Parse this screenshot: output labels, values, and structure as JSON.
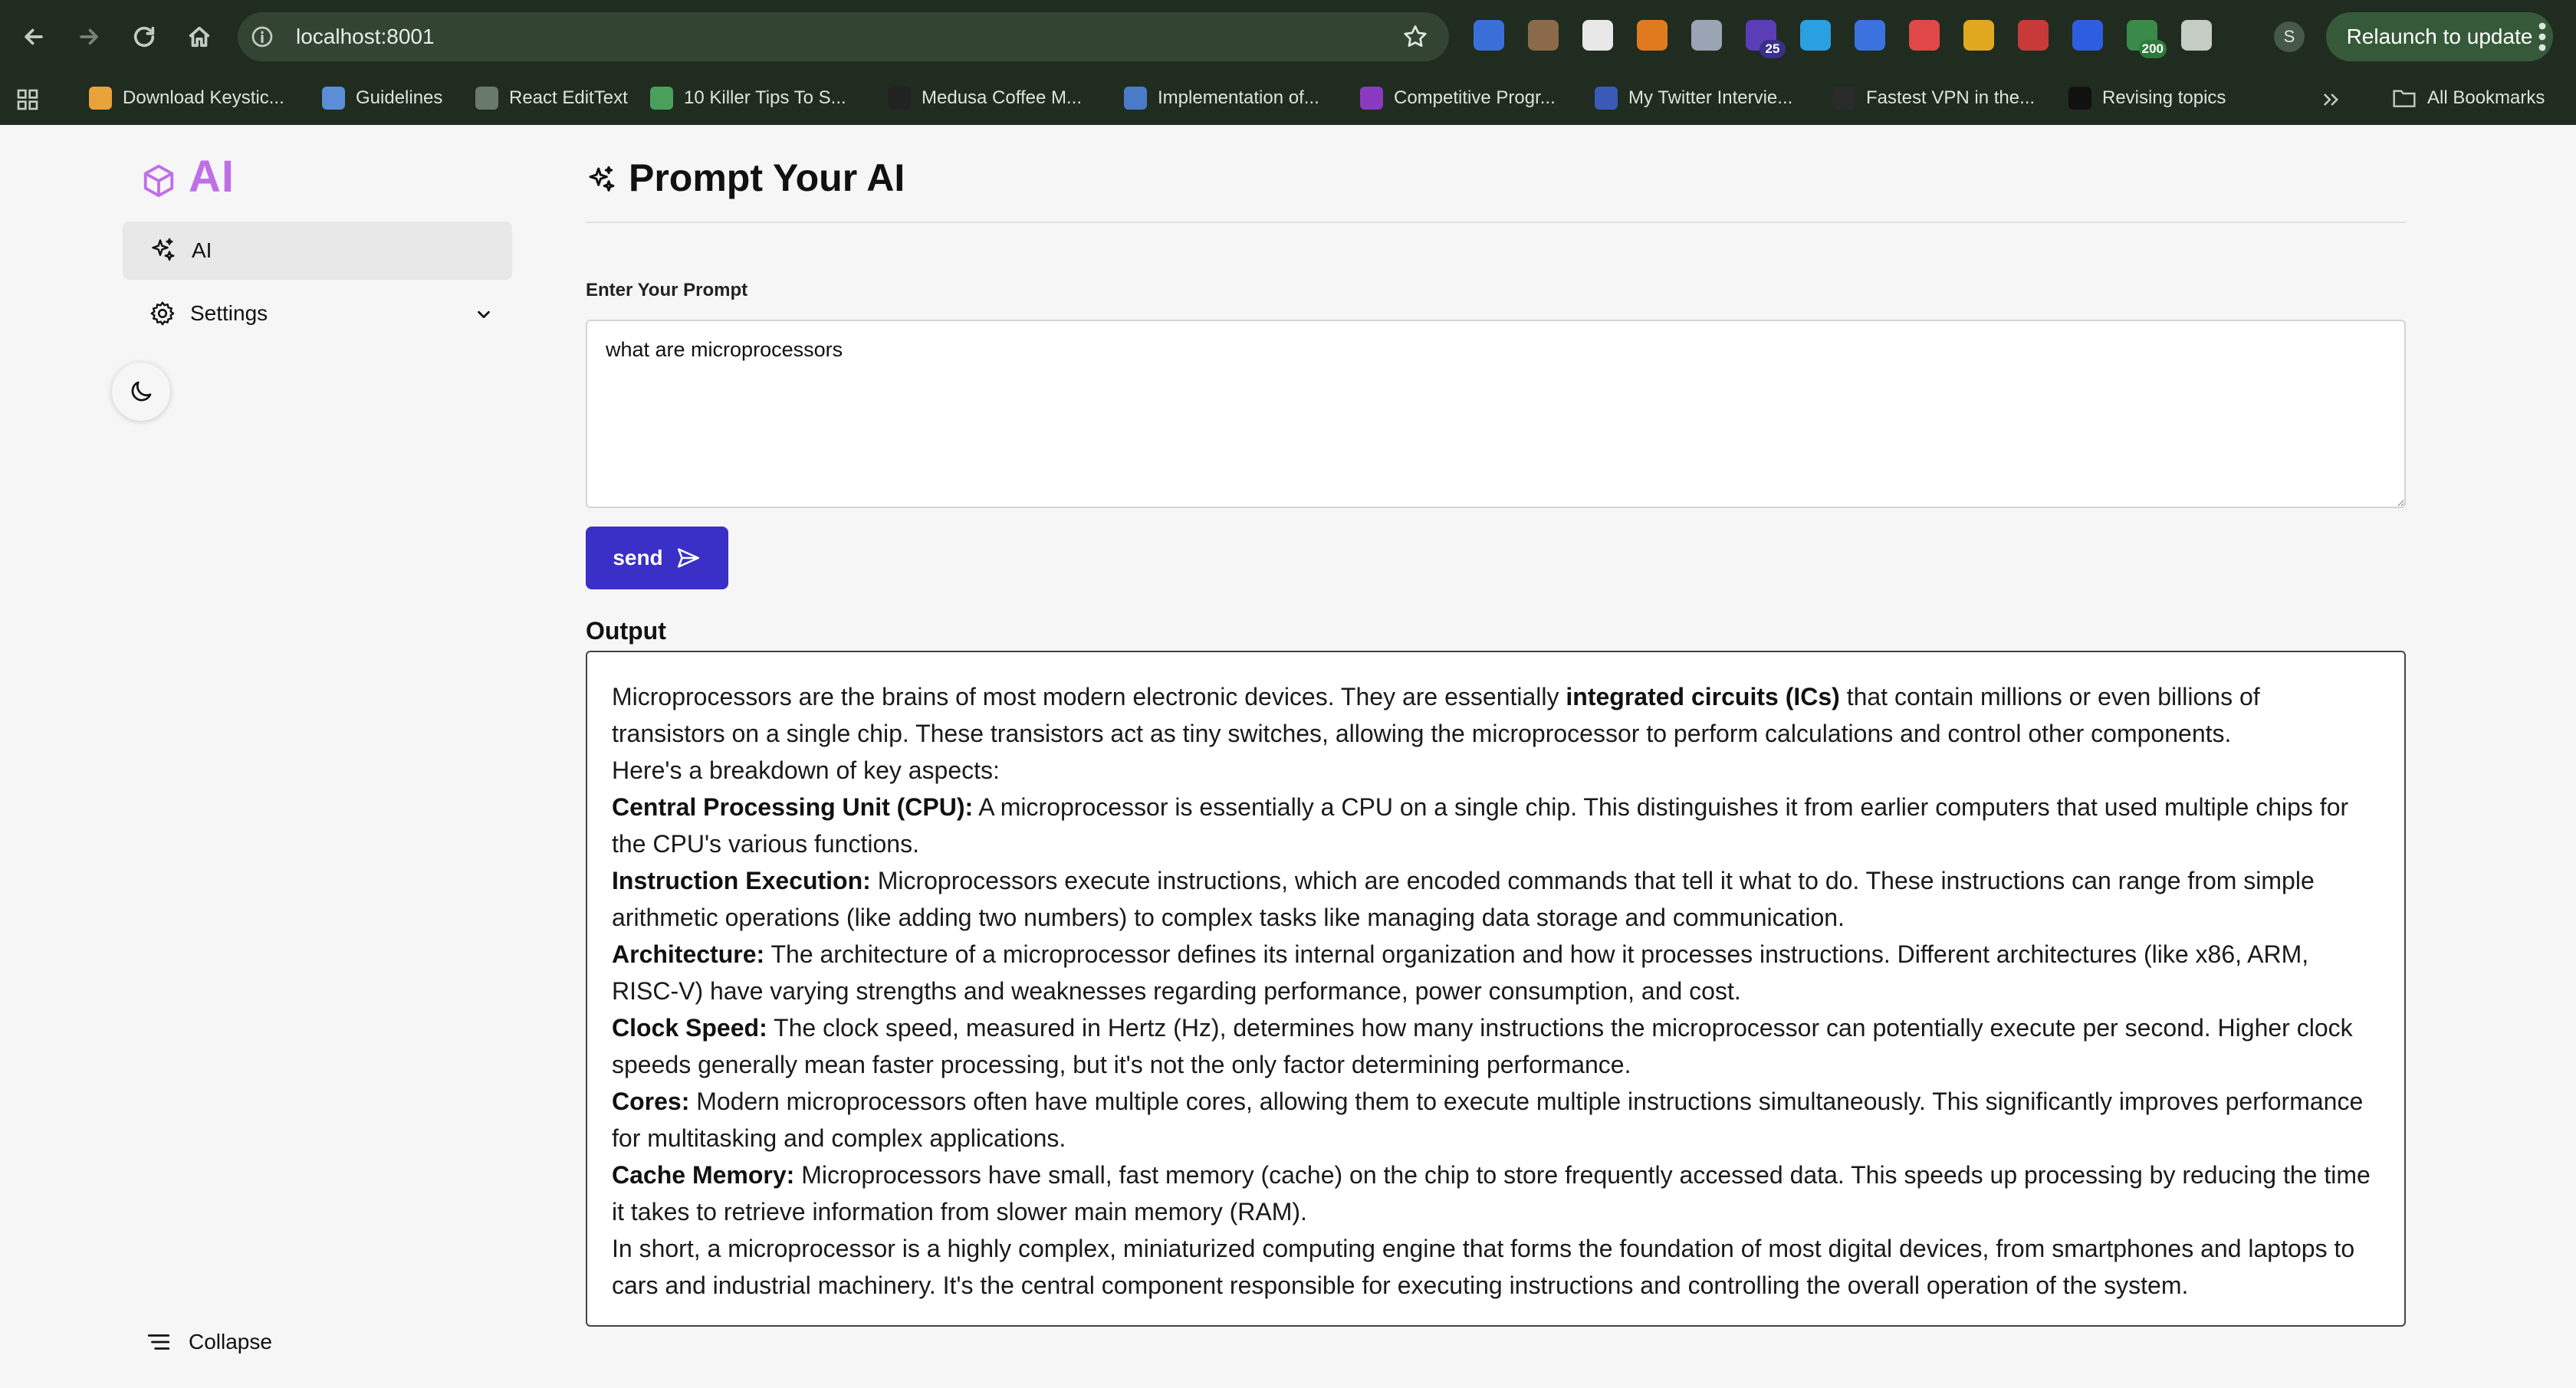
{
  "browser": {
    "url": "localhost:8001",
    "relaunch_label": "Relaunch to update",
    "profile_initial": "S",
    "extensions": [
      {
        "icon": "screencast-icon",
        "color": "#3b6fd8",
        "badge": ""
      },
      {
        "icon": "spy-glasses-icon",
        "color": "#8a6a4a",
        "badge": ""
      },
      {
        "icon": "text-t-icon",
        "color": "#e8e8e8",
        "badge": ""
      },
      {
        "icon": "orange-orb-icon",
        "color": "#e07a1e",
        "badge": ""
      },
      {
        "icon": "shield-icon",
        "color": "#9aa4b4",
        "badge": ""
      },
      {
        "icon": "purple-app-icon",
        "color": "#5b3db8",
        "badge": "25"
      },
      {
        "icon": "blue-square-icon",
        "color": "#2aa0e0",
        "badge": ""
      },
      {
        "icon": "book-icon",
        "color": "#3c72e0",
        "badge": ""
      },
      {
        "icon": "color-wheel-icon",
        "color": "#e04848",
        "badge": ""
      },
      {
        "icon": "sc-icon",
        "color": "#e0a81e",
        "badge": ""
      },
      {
        "icon": "grid-app-icon",
        "color": "#c83a3a",
        "badge": ""
      },
      {
        "icon": "translate-icon",
        "color": "#2e5ee0",
        "badge": ""
      },
      {
        "icon": "green-pig-icon",
        "color": "#3a8a4a",
        "badge": "200"
      },
      {
        "icon": "puzzle-icon",
        "color": "#c4ccc4",
        "badge": ""
      }
    ]
  },
  "bookmarks": [
    {
      "label": "Download Keystic...",
      "icon": "k-logo-icon",
      "color": "#e8a23a"
    },
    {
      "label": "Guidelines",
      "icon": "doc-logo-icon",
      "color": "#5a8ed8"
    },
    {
      "label": "React EditText",
      "icon": "globe-icon",
      "color": "#6a7a6a"
    },
    {
      "label": "10 Killer Tips To S...",
      "icon": "sun-logo-icon",
      "color": "#4aa05a"
    },
    {
      "label": "Medusa Coffee M...",
      "icon": "medusa-logo-icon",
      "color": "#222222"
    },
    {
      "label": "Implementation of...",
      "icon": "image-logo-icon",
      "color": "#4a7ac8"
    },
    {
      "label": "Competitive Progr...",
      "icon": "cp-logo-icon",
      "color": "#8a3ac0"
    },
    {
      "label": "My Twitter Intervie...",
      "icon": "co-logo-icon",
      "color": "#3a5ab8"
    },
    {
      "label": "Fastest VPN in the...",
      "icon": "vpn-logo-icon",
      "color": "#2a2a2a"
    },
    {
      "label": "Revising topics",
      "icon": "medium-logo-icon",
      "color": "#111111"
    }
  ],
  "all_bookmarks_label": "All Bookmarks",
  "sidebar": {
    "brand": "AI",
    "nav_ai_label": "AI",
    "nav_settings_label": "Settings",
    "collapse_label": "Collapse"
  },
  "main": {
    "title": "Prompt Your AI",
    "prompt_label": "Enter Your Prompt",
    "prompt_value": "what are microprocessors",
    "send_label": "send",
    "output_label": "Output",
    "output": {
      "intro_before": "Microprocessors are the brains of most modern electronic devices. They are essentially ",
      "intro_bold": "integrated circuits (ICs)",
      "intro_after": " that contain millions or even billions of transistors on a single chip. These transistors act as tiny switches, allowing the microprocessor to perform calculations and control other components.",
      "breakdown": "Here's a breakdown of key aspects:",
      "aspects": [
        {
          "term": "Central Processing Unit (CPU):",
          "text": " A microprocessor is essentially a CPU on a single chip. This distinguishes it from earlier computers that used multiple chips for the CPU's various functions."
        },
        {
          "term": "Instruction Execution:",
          "text": " Microprocessors execute instructions, which are encoded commands that tell it what to do. These instructions can range from simple arithmetic operations (like adding two numbers) to complex tasks like managing data storage and communication."
        },
        {
          "term": "Architecture:",
          "text": " The architecture of a microprocessor defines its internal organization and how it processes instructions. Different architectures (like x86, ARM, RISC-V) have varying strengths and weaknesses regarding performance, power consumption, and cost."
        },
        {
          "term": "Clock Speed:",
          "text": " The clock speed, measured in Hertz (Hz), determines how many instructions the microprocessor can potentially execute per second. Higher clock speeds generally mean faster processing, but it's not the only factor determining performance."
        },
        {
          "term": "Cores:",
          "text": " Modern microprocessors often have multiple cores, allowing them to execute multiple instructions simultaneously. This significantly improves performance for multitasking and complex applications."
        },
        {
          "term": "Cache Memory:",
          "text": " Microprocessors have small, fast memory (cache) on the chip to store frequently accessed data. This speeds up processing by reducing the time it takes to retrieve information from slower main memory (RAM)."
        }
      ],
      "summary": "In short, a microprocessor is a highly complex, miniaturized computing engine that forms the foundation of most digital devices, from smartphones and laptops to cars and industrial machinery. It's the central component responsible for executing instructions and controlling the overall operation of the system."
    }
  },
  "colors": {
    "chrome_bg": "#1f2c1f",
    "brand_purple": "#c06ee8",
    "send_button": "#3a2fc6",
    "relaunch_button": "#365a39"
  }
}
